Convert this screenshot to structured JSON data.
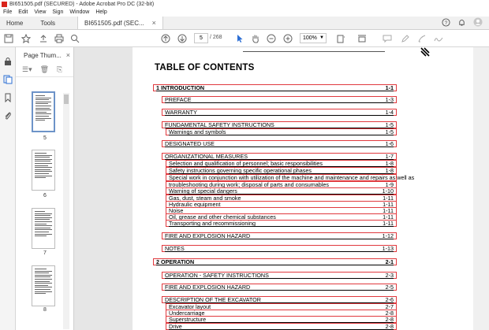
{
  "window": {
    "title": "BI651505.pdf (SECURED) - Adobe Acrobat Pro DC (32-bit)"
  },
  "menu": [
    "File",
    "Edit",
    "View",
    "Sign",
    "Window",
    "Help"
  ],
  "tabs": {
    "home": "Home",
    "tools": "Tools",
    "doc": "BI651505.pdf (SEC...",
    "close": "×"
  },
  "toolbar": {
    "page_current": "5",
    "page_total": "/ 268",
    "zoom": "100%"
  },
  "thumbnails": {
    "title": "Page Thum...",
    "pages": [
      "5",
      "6",
      "7",
      "8"
    ]
  },
  "toc": {
    "title": "TABLE OF CONTENTS",
    "entries": [
      {
        "text": "1   INTRODUCTION",
        "page": "1-1"
      },
      {
        "text": "PREFACE",
        "page": "1-3"
      },
      {
        "text": "WARRANTY",
        "page": "1-4"
      },
      {
        "text": "FUNDAMENTAL SAFETY INSTRUCTIONS",
        "page": "1-5"
      },
      {
        "text": "Warnings and symbols",
        "page": "1-5"
      },
      {
        "text": "DESIGNATED USE",
        "page": "1-6"
      },
      {
        "text": "ORGANIZATIONAL MEASURES",
        "page": "1-7"
      },
      {
        "text": "Selection and qualification of personnel; basic responsibilities",
        "page": "1-8"
      },
      {
        "text": "Safety instructions governing specific operational phases",
        "page": "1-8"
      },
      {
        "text": "Special work in conjunction with utilization of the machine and maintenance and repairs as well as",
        "page": ""
      },
      {
        "text": "troubleshooting during work; disposal of parts and consumables",
        "page": "1-9"
      },
      {
        "text": "Warning of special dangers",
        "page": "1-10"
      },
      {
        "text": "Gas, dust, steam and smoke",
        "page": "1-11"
      },
      {
        "text": "Hydraulic equipment",
        "page": "1-11"
      },
      {
        "text": "Noise",
        "page": "1-11"
      },
      {
        "text": "Oil, grease and other chemical substances",
        "page": "1-11"
      },
      {
        "text": "Transporting and recommissioning",
        "page": "1-11"
      },
      {
        "text": "FIRE AND EXPLOSION HAZARD",
        "page": "1-12"
      },
      {
        "text": "NOTES",
        "page": "1-13"
      },
      {
        "text": "2   OPERATION",
        "page": "2-1"
      },
      {
        "text": "OPERATION - SAFETY INSTRUCTIONS",
        "page": "2-3"
      },
      {
        "text": "FIRE AND EXPLOSION HAZARD",
        "page": "2-5"
      },
      {
        "text": "DESCRIPTION OF THE EXCAVATOR",
        "page": "2-6"
      },
      {
        "text": "Excavator layout",
        "page": "2-7"
      },
      {
        "text": "Undercarriage",
        "page": "2-8"
      },
      {
        "text": "Superstructure",
        "page": "2-8"
      },
      {
        "text": "Drive",
        "page": "2-8"
      }
    ]
  }
}
